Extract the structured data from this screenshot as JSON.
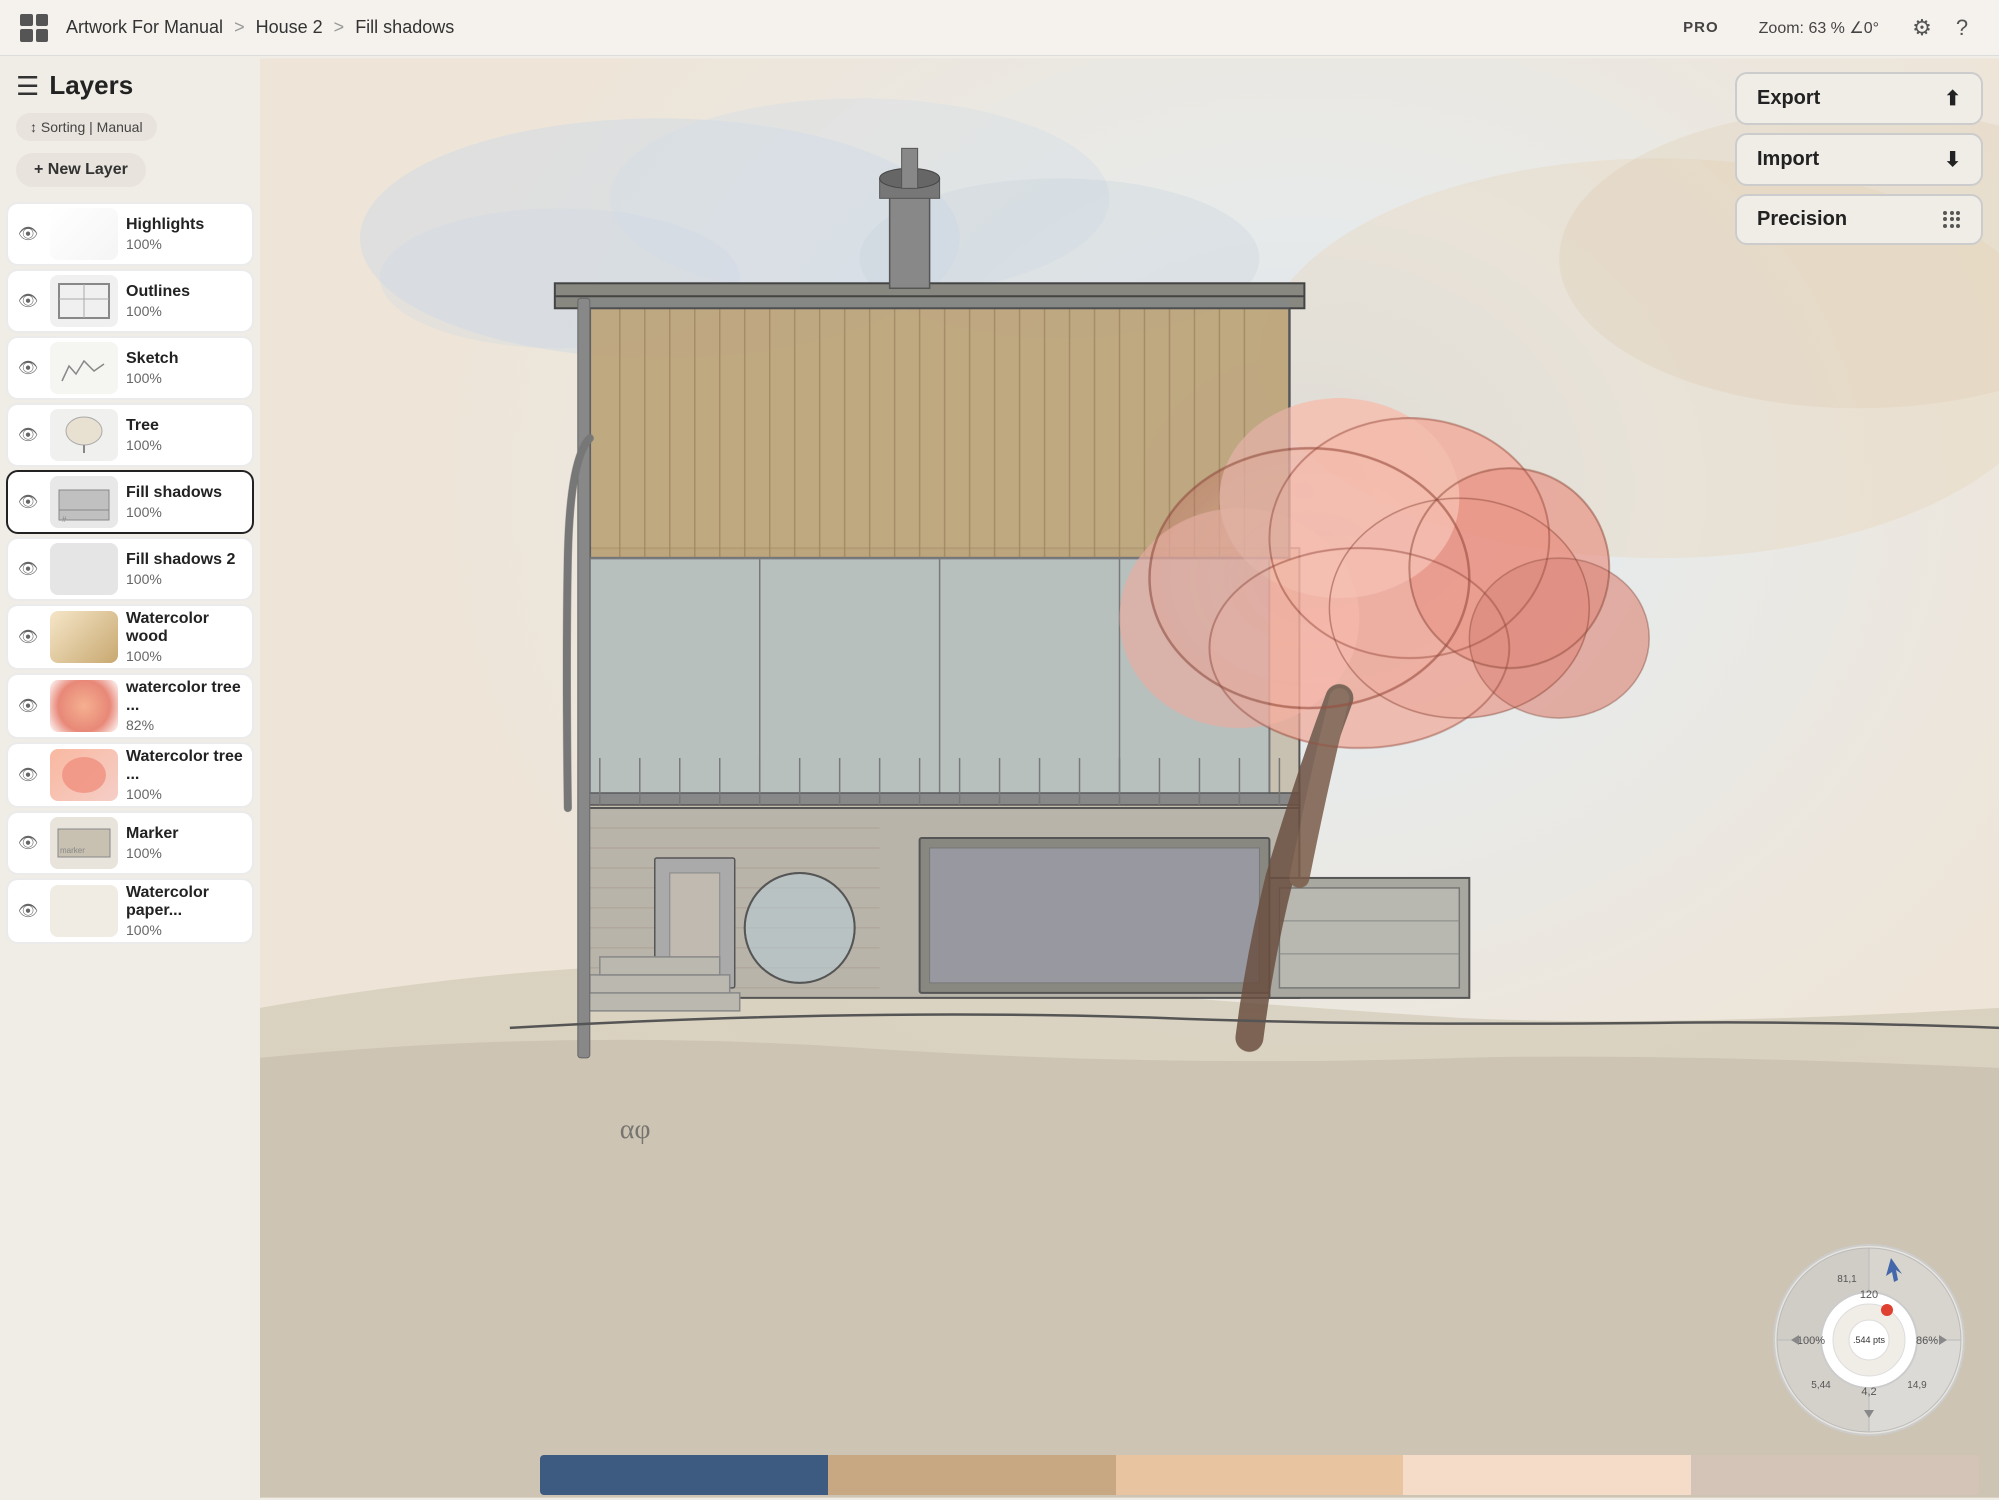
{
  "topbar": {
    "grid_icon_label": "grid",
    "breadcrumb": {
      "part1": "Artwork For Manual",
      "sep1": ">",
      "part2": "House 2",
      "sep2": ">",
      "part3": "Fill shadows"
    },
    "pro_label": "PRO",
    "zoom_label": "Zoom:",
    "zoom_value": "63 %",
    "zoom_angle": "∠0°",
    "gear_label": "⚙",
    "help_label": "?"
  },
  "sidebar": {
    "title": "Layers",
    "sorting_label": "↕ Sorting | Manual",
    "new_layer_label": "+ New Layer",
    "layers": [
      {
        "id": "highlights",
        "name": "Highlights",
        "opacity": "100%",
        "visible": true,
        "selected": false,
        "thumb_class": "thumb-highlights"
      },
      {
        "id": "outlines",
        "name": "Outlines",
        "opacity": "100%",
        "visible": true,
        "selected": false,
        "thumb_class": "thumb-outlines"
      },
      {
        "id": "sketch",
        "name": "Sketch",
        "opacity": "100%",
        "visible": true,
        "selected": false,
        "thumb_class": "thumb-sketch"
      },
      {
        "id": "tree",
        "name": "Tree",
        "opacity": "100%",
        "visible": true,
        "selected": false,
        "thumb_class": "thumb-tree"
      },
      {
        "id": "fill-shadows",
        "name": "Fill shadows",
        "opacity": "100%",
        "visible": true,
        "selected": true,
        "thumb_class": "thumb-fillshadows"
      },
      {
        "id": "fill-shadows-2",
        "name": "Fill shadows 2",
        "opacity": "100%",
        "visible": true,
        "selected": false,
        "thumb_class": "thumb-fillshadows2"
      },
      {
        "id": "watercolor-wood",
        "name": "Watercolor wood",
        "opacity": "100%",
        "visible": true,
        "selected": false,
        "thumb_class": "thumb-watercolorwood"
      },
      {
        "id": "watercolor-tree",
        "name": "watercolor tree ...",
        "opacity": "82%",
        "visible": true,
        "selected": false,
        "thumb_class": "thumb-watercolortree"
      },
      {
        "id": "watercolor-tree-2",
        "name": "Watercolor tree ...",
        "opacity": "100%",
        "visible": true,
        "selected": false,
        "thumb_class": "thumb-watercolortree2"
      },
      {
        "id": "marker",
        "name": "Marker",
        "opacity": "100%",
        "visible": true,
        "selected": false,
        "thumb_class": "thumb-marker"
      },
      {
        "id": "watercolor-paper",
        "name": "Watercolor paper...",
        "opacity": "100%",
        "visible": true,
        "selected": false,
        "thumb_class": "thumb-watercolorpaper"
      }
    ]
  },
  "right_panel": {
    "export_label": "Export",
    "import_label": "Import",
    "precision_label": "Precision",
    "grid_icon_label": "grid-dots"
  },
  "precision_dial": {
    "pts_label": ".544 pts",
    "percent1": "100%",
    "percent2": "86%",
    "num1": "81,1",
    "num2": "5,44",
    "num3": "14,9",
    "num4": "4,2",
    "num5": "120"
  },
  "colors": [
    "#3d5a80",
    "#c8a882",
    "#e8c4a0",
    "#f5dcc8",
    "#d4c4b8"
  ]
}
